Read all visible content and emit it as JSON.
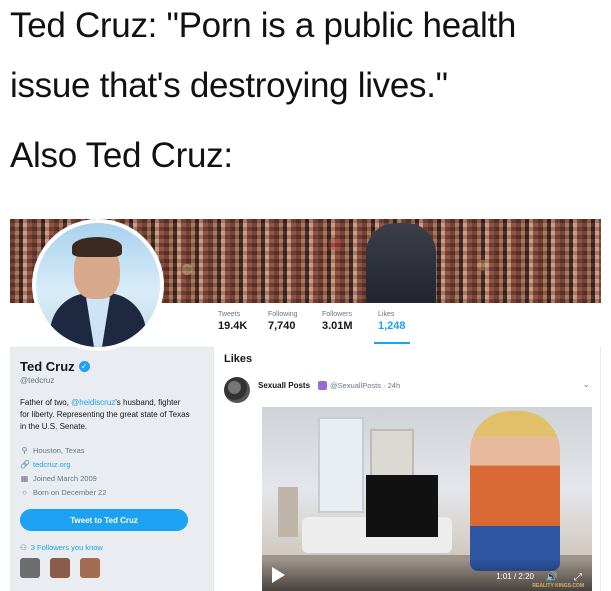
{
  "captions": {
    "line1": "Ted Cruz: \"Porn is a public health",
    "line2": "issue that's destroying lives.\"",
    "line3": "Also Ted Cruz:"
  },
  "profile": {
    "stats": [
      {
        "label": "Tweets",
        "value": "19.4K"
      },
      {
        "label": "Following",
        "value": "7,740"
      },
      {
        "label": "Followers",
        "value": "3.01M"
      },
      {
        "label": "Likes",
        "value": "1,248",
        "active": true
      }
    ],
    "name": "Ted Cruz",
    "verified_icon": "check-icon",
    "handle": "@tedcruz",
    "bio_prefix": "Father of two, ",
    "bio_mention": "@heidiscruz",
    "bio_suffix": "'s husband, fighter for liberty. Representing the great state of Texas in the U.S. Senate.",
    "location": "Houston, Texas",
    "website": "tedcruz.org",
    "joined": "Joined March 2009",
    "born": "Born on December 22",
    "tweet_button": "Tweet to Ted Cruz",
    "followers_you_know": "3 Followers you know",
    "accent_color": "#1da1f2"
  },
  "likes": {
    "title": "Likes",
    "tweet": {
      "author": "Sexuall Posts",
      "handle_time": "@SexuallPosts · 24h",
      "video_time": "1:01 / 2:20",
      "watermark": "REALITY KINGS.COM"
    }
  }
}
